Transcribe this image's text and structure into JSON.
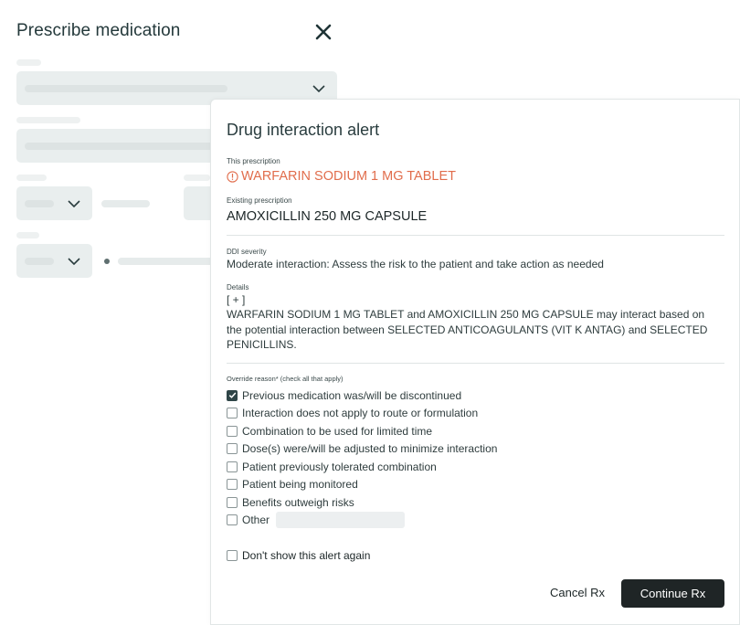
{
  "background": {
    "title": "Prescribe medication",
    "close_icon": "close-icon"
  },
  "modal": {
    "title": "Drug interaction alert",
    "this_prescription_label": "This prescription",
    "this_prescription_value": "WARFARIN SODIUM 1 MG TABLET",
    "existing_prescription_label": "Existing prescription",
    "existing_prescription_value": "AMOXICILLIN 250 MG CAPSULE",
    "severity_label": "DDI severity",
    "severity_value": "Moderate interaction: Assess the risk to the patient and take action as needed",
    "details_label": "Details",
    "details_toggle": "[ + ]",
    "details_text": "WARFARIN SODIUM 1 MG TABLET and AMOXICILLIN 250 MG CAPSULE may interact based on the potential interaction between SELECTED ANTICOAGULANTS (VIT K ANTAG) and SELECTED PENICILLINS.",
    "override_label": "Override reason* (check all that apply)",
    "override_options": [
      {
        "label": "Previous medication was/will be  discontinued",
        "checked": true
      },
      {
        "label": "Interaction does not apply to route or formulation",
        "checked": false
      },
      {
        "label": "Combination to be used for limited time",
        "checked": false
      },
      {
        "label": "Dose(s) were/will be adjusted to minimize interaction",
        "checked": false
      },
      {
        "label": "Patient previously tolerated combination",
        "checked": false
      },
      {
        "label": "Patient being monitored",
        "checked": false
      },
      {
        "label": "Benefits outweigh risks",
        "checked": false
      },
      {
        "label": "Other",
        "checked": false
      }
    ],
    "other_input_value": "",
    "dont_show_label": "Don't show this alert again",
    "cancel_label": "Cancel Rx",
    "continue_label": "Continue Rx"
  },
  "colors": {
    "alert": "#e16d4c",
    "primary_button": "#1f2526",
    "checkbox_checked": "#2f4547",
    "placeholder": "#e9eeee"
  }
}
